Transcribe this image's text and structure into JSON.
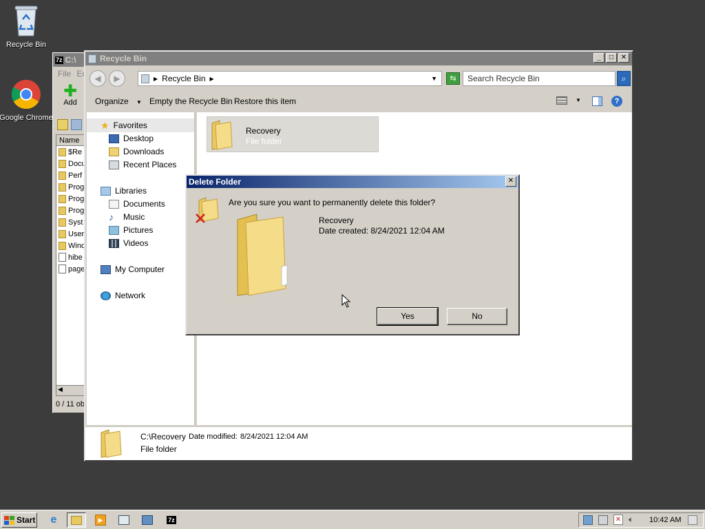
{
  "desktop": {
    "icons": [
      {
        "label": "Recycle Bin",
        "icon": "recycle-bin-icon"
      },
      {
        "label": "Google Chrome",
        "icon": "chrome-icon"
      }
    ]
  },
  "zip_window": {
    "title": "C:\\",
    "menu": [
      "File",
      "Ec"
    ],
    "add_label": "Add",
    "column": "Name",
    "rows": [
      "$Re",
      "Docu",
      "Perf",
      "Prog",
      "Prog",
      "Prog",
      "Syst",
      "User",
      "Wind",
      "hibe",
      "page"
    ],
    "status": "0 / 11 ob"
  },
  "explorer": {
    "title": "Recycle Bin",
    "breadcrumb": "Recycle Bin",
    "search_placeholder": "Search Recycle Bin",
    "commands": {
      "organize": "Organize",
      "empty": "Empty the Recycle Bin",
      "restore": "Restore this item"
    },
    "nav": {
      "favorites": "Favorites",
      "desktop": "Desktop",
      "downloads": "Downloads",
      "recent": "Recent Places",
      "libraries": "Libraries",
      "documents": "Documents",
      "music": "Music",
      "pictures": "Pictures",
      "videos": "Videos",
      "computer": "My Computer",
      "network": "Network"
    },
    "item": {
      "name": "Recovery",
      "type": "File folder"
    },
    "details": {
      "path": "C:\\Recovery",
      "modified_label": "Date modified:",
      "modified_value": "8/24/2021 12:04 AM",
      "type": "File folder"
    }
  },
  "dialog": {
    "title": "Delete Folder",
    "question": "Are you sure you want to permanently delete this folder?",
    "item_name": "Recovery",
    "date_created": "Date created: 8/24/2021 12:04 AM",
    "yes_label": "Yes",
    "no_label": "No"
  },
  "taskbar": {
    "start_label": "Start",
    "clock": "10:42 AM"
  }
}
